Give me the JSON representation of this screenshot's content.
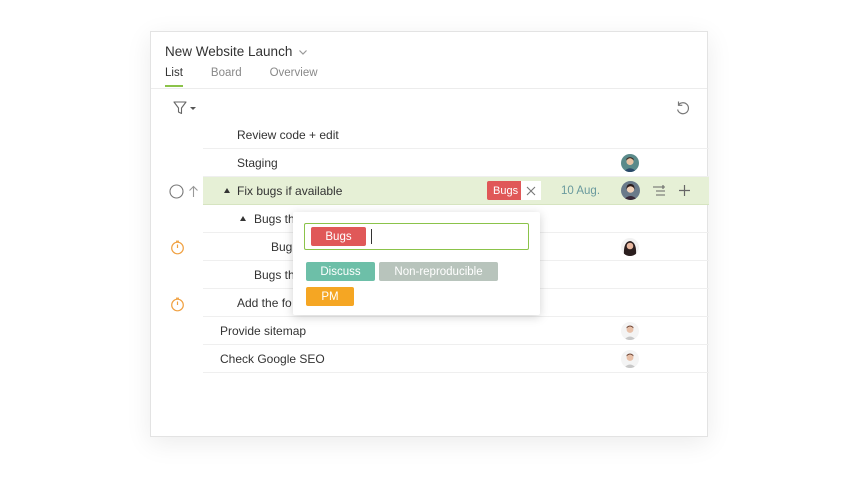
{
  "project": {
    "title": "New Website Launch"
  },
  "tabs": [
    {
      "label": "List",
      "active": true
    },
    {
      "label": "Board",
      "active": false
    },
    {
      "label": "Overview",
      "active": false
    }
  ],
  "tasks": [
    {
      "label": "Review code + edit"
    },
    {
      "label": "Staging"
    },
    {
      "label": "Fix bugs if available",
      "tag": "Bugs",
      "date": "10 Aug."
    },
    {
      "label": "Bugs th"
    },
    {
      "label": "Bug"
    },
    {
      "label": "Bugs th"
    },
    {
      "label": "Add the fo"
    },
    {
      "label": "Provide sitemap"
    },
    {
      "label": "Check Google SEO"
    }
  ],
  "tag_popup": {
    "selected": [
      "Bugs"
    ],
    "options": [
      "Discuss",
      "Non-reproducible",
      "PM"
    ]
  },
  "colors": {
    "accent": "#8bc34a",
    "active_row": "#e6f0d6",
    "tag_bugs": "#e05858",
    "tag_discuss": "#6dbfa8",
    "tag_nonrepro": "#b8c4bc",
    "tag_pm": "#f5a623",
    "date": "#6a9a9e",
    "timer": "#f0a040"
  }
}
